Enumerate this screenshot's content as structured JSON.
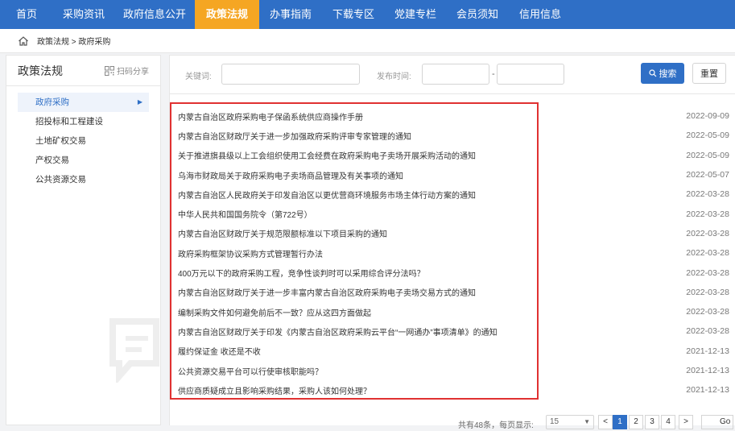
{
  "nav": {
    "items": [
      {
        "label": "首页",
        "active": false
      },
      {
        "label": "采购资讯",
        "active": false
      },
      {
        "label": "政府信息公开",
        "active": false
      },
      {
        "label": "政策法规",
        "active": true
      },
      {
        "label": "办事指南",
        "active": false
      },
      {
        "label": "下载专区",
        "active": false
      },
      {
        "label": "党建专栏",
        "active": false
      },
      {
        "label": "会员须知",
        "active": false
      },
      {
        "label": "信用信息",
        "active": false
      }
    ]
  },
  "breadcrumb": "政策法规 > 政府采购",
  "sidebar": {
    "title": "政策法规",
    "share_label": "扫码分享",
    "items": [
      {
        "label": "政府采购",
        "active": true
      },
      {
        "label": "招投标和工程建设",
        "active": false
      },
      {
        "label": "土地矿权交易",
        "active": false
      },
      {
        "label": "产权交易",
        "active": false
      },
      {
        "label": "公共资源交易",
        "active": false
      }
    ]
  },
  "search": {
    "keyword_label": "关键词:",
    "keyword_value": "",
    "date_label": "发布时间:",
    "date_start": "",
    "date_end": "",
    "date_separator": "-",
    "search_label": "搜索",
    "reset_label": "重置"
  },
  "articles": [
    {
      "title": "内蒙古自治区政府采购电子保函系统供应商操作手册",
      "date": "2022-09-09"
    },
    {
      "title": "内蒙古自治区财政厅关于进一步加强政府采购评审专家管理的通知",
      "date": "2022-05-09"
    },
    {
      "title": "关于推进旗县级以上工会组织使用工会经费在政府采购电子卖场开展采购活动的通知",
      "date": "2022-05-09"
    },
    {
      "title": "乌海市财政局关于政府采购电子卖场商品管理及有关事项的通知",
      "date": "2022-05-07"
    },
    {
      "title": "内蒙古自治区人民政府关于印发自治区以更优营商环境服务市场主体行动方案的通知",
      "date": "2022-03-28"
    },
    {
      "title": "中华人民共和国国务院令（第722号）",
      "date": "2022-03-28"
    },
    {
      "title": "内蒙古自治区财政厅关于规范限额标准以下项目采购的通知",
      "date": "2022-03-28"
    },
    {
      "title": "政府采购框架协议采购方式管理暂行办法",
      "date": "2022-03-28"
    },
    {
      "title": "400万元以下的政府采购工程，竞争性谈判时可以采用综合评分法吗？",
      "date": "2022-03-28"
    },
    {
      "title": "内蒙古自治区财政厅关于进一步丰富内蒙古自治区政府采购电子卖场交易方式的通知",
      "date": "2022-03-28"
    },
    {
      "title": "编制采购文件如何避免前后不一致？应从这四方面做起",
      "date": "2022-03-28"
    },
    {
      "title": "内蒙古自治区财政厅关于印发《内蒙古自治区政府采购云平台“一网通办”事项清单》的通知",
      "date": "2022-03-28"
    },
    {
      "title": "履约保证金 收还是不收",
      "date": "2021-12-13"
    },
    {
      "title": "公共资源交易平台可以行使审核职能吗？",
      "date": "2021-12-13"
    },
    {
      "title": "供应商质疑成立且影响采购结果，采购人该如何处理？",
      "date": "2021-12-13"
    }
  ],
  "pager": {
    "total_text": "共有48条，每页显示:",
    "page_size": "15",
    "prev": "<",
    "pages": [
      "1",
      "2",
      "3",
      "4"
    ],
    "current": "1",
    "next": ">",
    "go_label": "Go"
  },
  "colors": {
    "nav_bg": "#2f6fc6",
    "nav_active": "#f5a623",
    "highlight": "#e03131"
  }
}
